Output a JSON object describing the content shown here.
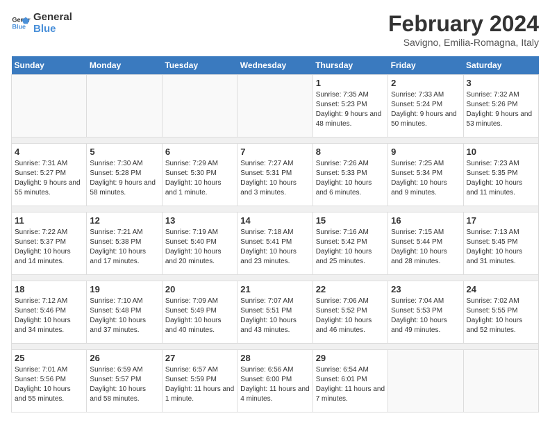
{
  "header": {
    "logo_line1": "General",
    "logo_line2": "Blue",
    "month_year": "February 2024",
    "location": "Savigno, Emilia-Romagna, Italy"
  },
  "days_of_week": [
    "Sunday",
    "Monday",
    "Tuesday",
    "Wednesday",
    "Thursday",
    "Friday",
    "Saturday"
  ],
  "weeks": [
    [
      {
        "day": "",
        "info": ""
      },
      {
        "day": "",
        "info": ""
      },
      {
        "day": "",
        "info": ""
      },
      {
        "day": "",
        "info": ""
      },
      {
        "day": "1",
        "info": "Sunrise: 7:35 AM\nSunset: 5:23 PM\nDaylight: 9 hours and 48 minutes."
      },
      {
        "day": "2",
        "info": "Sunrise: 7:33 AM\nSunset: 5:24 PM\nDaylight: 9 hours and 50 minutes."
      },
      {
        "day": "3",
        "info": "Sunrise: 7:32 AM\nSunset: 5:26 PM\nDaylight: 9 hours and 53 minutes."
      }
    ],
    [
      {
        "day": "4",
        "info": "Sunrise: 7:31 AM\nSunset: 5:27 PM\nDaylight: 9 hours and 55 minutes."
      },
      {
        "day": "5",
        "info": "Sunrise: 7:30 AM\nSunset: 5:28 PM\nDaylight: 9 hours and 58 minutes."
      },
      {
        "day": "6",
        "info": "Sunrise: 7:29 AM\nSunset: 5:30 PM\nDaylight: 10 hours and 1 minute."
      },
      {
        "day": "7",
        "info": "Sunrise: 7:27 AM\nSunset: 5:31 PM\nDaylight: 10 hours and 3 minutes."
      },
      {
        "day": "8",
        "info": "Sunrise: 7:26 AM\nSunset: 5:33 PM\nDaylight: 10 hours and 6 minutes."
      },
      {
        "day": "9",
        "info": "Sunrise: 7:25 AM\nSunset: 5:34 PM\nDaylight: 10 hours and 9 minutes."
      },
      {
        "day": "10",
        "info": "Sunrise: 7:23 AM\nSunset: 5:35 PM\nDaylight: 10 hours and 11 minutes."
      }
    ],
    [
      {
        "day": "11",
        "info": "Sunrise: 7:22 AM\nSunset: 5:37 PM\nDaylight: 10 hours and 14 minutes."
      },
      {
        "day": "12",
        "info": "Sunrise: 7:21 AM\nSunset: 5:38 PM\nDaylight: 10 hours and 17 minutes."
      },
      {
        "day": "13",
        "info": "Sunrise: 7:19 AM\nSunset: 5:40 PM\nDaylight: 10 hours and 20 minutes."
      },
      {
        "day": "14",
        "info": "Sunrise: 7:18 AM\nSunset: 5:41 PM\nDaylight: 10 hours and 23 minutes."
      },
      {
        "day": "15",
        "info": "Sunrise: 7:16 AM\nSunset: 5:42 PM\nDaylight: 10 hours and 25 minutes."
      },
      {
        "day": "16",
        "info": "Sunrise: 7:15 AM\nSunset: 5:44 PM\nDaylight: 10 hours and 28 minutes."
      },
      {
        "day": "17",
        "info": "Sunrise: 7:13 AM\nSunset: 5:45 PM\nDaylight: 10 hours and 31 minutes."
      }
    ],
    [
      {
        "day": "18",
        "info": "Sunrise: 7:12 AM\nSunset: 5:46 PM\nDaylight: 10 hours and 34 minutes."
      },
      {
        "day": "19",
        "info": "Sunrise: 7:10 AM\nSunset: 5:48 PM\nDaylight: 10 hours and 37 minutes."
      },
      {
        "day": "20",
        "info": "Sunrise: 7:09 AM\nSunset: 5:49 PM\nDaylight: 10 hours and 40 minutes."
      },
      {
        "day": "21",
        "info": "Sunrise: 7:07 AM\nSunset: 5:51 PM\nDaylight: 10 hours and 43 minutes."
      },
      {
        "day": "22",
        "info": "Sunrise: 7:06 AM\nSunset: 5:52 PM\nDaylight: 10 hours and 46 minutes."
      },
      {
        "day": "23",
        "info": "Sunrise: 7:04 AM\nSunset: 5:53 PM\nDaylight: 10 hours and 49 minutes."
      },
      {
        "day": "24",
        "info": "Sunrise: 7:02 AM\nSunset: 5:55 PM\nDaylight: 10 hours and 52 minutes."
      }
    ],
    [
      {
        "day": "25",
        "info": "Sunrise: 7:01 AM\nSunset: 5:56 PM\nDaylight: 10 hours and 55 minutes."
      },
      {
        "day": "26",
        "info": "Sunrise: 6:59 AM\nSunset: 5:57 PM\nDaylight: 10 hours and 58 minutes."
      },
      {
        "day": "27",
        "info": "Sunrise: 6:57 AM\nSunset: 5:59 PM\nDaylight: 11 hours and 1 minute."
      },
      {
        "day": "28",
        "info": "Sunrise: 6:56 AM\nSunset: 6:00 PM\nDaylight: 11 hours and 4 minutes."
      },
      {
        "day": "29",
        "info": "Sunrise: 6:54 AM\nSunset: 6:01 PM\nDaylight: 11 hours and 7 minutes."
      },
      {
        "day": "",
        "info": ""
      },
      {
        "day": "",
        "info": ""
      }
    ]
  ]
}
